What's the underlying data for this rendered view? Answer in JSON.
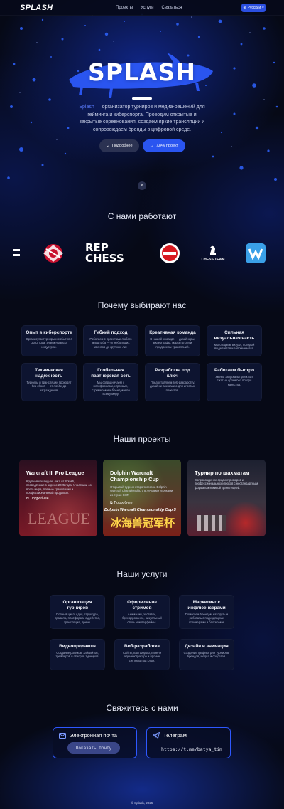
{
  "header": {
    "logo": "SPLASH",
    "nav": [
      "Проекты",
      "Услуги",
      "Связаться"
    ],
    "lang": "Русский"
  },
  "hero": {
    "logo": "SPLASH",
    "brand": "Splash",
    "description": " — организатор турниров и медиа-решений для гейминга и киберспорта. Проводим открытые и закрытые соревнования, создаём яркие трансляции и сопровождаем бренды в цифровой среде.",
    "btn_more": "Подробнее",
    "btn_want": "Хочу проект"
  },
  "partners": {
    "title": "С нами работают",
    "rep_chess_line1": "REP",
    "rep_chess_line2": "CHESS",
    "chess_team": "CHESS TEAM"
  },
  "why": {
    "title": "Почему выбирают нас",
    "cards": [
      {
        "title": "Опыт в киберспорте",
        "text": "Организуем турниры и события с 2023 года, знаем нюансы индустрии."
      },
      {
        "title": "Гибкий подход",
        "text": "Работаем с проектами любого масштаба — от небольших ивентов до крупных лиг."
      },
      {
        "title": "Креативная команда",
        "text": "В нашей команде — дизайнеры, видеографы, маркетологи и продюсеры трансляций."
      },
      {
        "title": "Сильная визуальная часть",
        "text": "Мы создаём визуал, который выделяется и запоминается."
      },
      {
        "title": "Техническая надёжность",
        "text": "Турниры и трансляции проходят без сбоев — от лобби до награждения."
      },
      {
        "title": "Глобальная партнерская сеть",
        "text": "Мы сотрудничаем с платформами, игроками, стримерами и брендами по всему миру."
      },
      {
        "title": "Разработка под ключ",
        "text": "Предоставляем веб-разработку, дизайн и анимацию для игровых проектов."
      },
      {
        "title": "Работаем быстро",
        "text": "Умеем запускать проекты в сжатые сроки без потери качества."
      }
    ]
  },
  "projects": {
    "title": "Наши проекты",
    "items": [
      {
        "title": "Warcraft III Pro League",
        "text": "Крупная командная лига от Splash, проведённая в апреле 2025 года. Участники со всего мира, прямые трансляции и профессиональный продакшн.",
        "link": "Подробнее",
        "art": "LEAGUE"
      },
      {
        "title": "Dolphin Warcraft Championship Cup",
        "text": "Открытый турнир второго сезона Dolphin Warcraft Championship с 8 лучшими игроками из стран СНГ.",
        "link": "Подробнее",
        "art": "Dolphin Warcraft Championship Cup 5",
        "art_cn": "冰海兽冠军杯"
      },
      {
        "title": "Турнир по шахматам",
        "text": "Сопровождение среди стримеров и профессиональных игроков с нестандартным форматом и живой трансляцией."
      }
    ]
  },
  "services": {
    "title": "Наши услуги",
    "cards": [
      {
        "title": "Организация турниров",
        "text": "Полный цикл: идея, структура, правила, платформа, судейство, трансляция, призы."
      },
      {
        "title": "Оформление стримов",
        "text": "Анимации, заставки, брендирование, визуальный стиль и интерфейсы."
      },
      {
        "title": "Маркетинг с инфлюенсерами",
        "text": "Помогаем брендам находить и работать с подходящими стримерами и блогерами."
      },
      {
        "title": "Видеопродакшн",
        "text": "Создание роликов, хайлайтов, трейлеров и обзоров турниров."
      },
      {
        "title": "Веб-разработка",
        "text": "Сайты, платформы, панели администратора и прочие системы под ключ."
      },
      {
        "title": "Дизайн и анимация",
        "text": "Создание графики для турниров, брендов, медиа и соцсетей."
      }
    ]
  },
  "contact": {
    "title": "Свяжитесь с нами",
    "email_label": "Электронная почта",
    "email_button": "Показать почту",
    "tg_label": "Телеграм",
    "tg_link": "https://t.me/batya_tim"
  },
  "footer": "© Splash, 2025",
  "colors": {
    "accent": "#2a55f0",
    "background": "#060916",
    "card": "#0d1430",
    "border": "#2e58ff"
  }
}
